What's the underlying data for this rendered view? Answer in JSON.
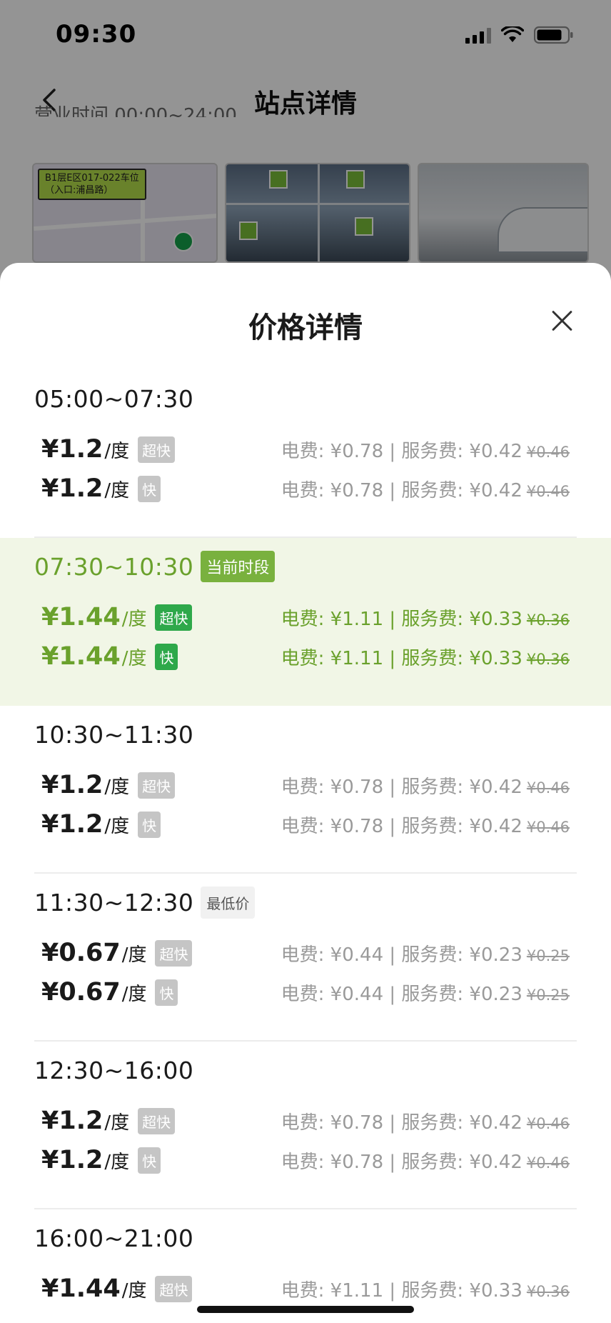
{
  "status_bar": {
    "time": "09:30"
  },
  "header": {
    "title": "站点详情"
  },
  "background": {
    "hours_text": "营业时间 00:00~24:00",
    "map_tag_line1": "B1层E区017-022车位",
    "map_tag_line2": "（入口:浦昌路）"
  },
  "sheet": {
    "title": "价格详情",
    "unit": "/度",
    "periods": [
      {
        "time": "05:00~07:30",
        "rows": [
          {
            "price": "¥1.2",
            "speed": "超快",
            "breakdown": "电费: ¥0.78 | 服务费: ¥0.42",
            "original": "¥0.46"
          },
          {
            "price": "¥1.2",
            "speed": "快",
            "breakdown": "电费: ¥0.78 | 服务费: ¥0.42",
            "original": "¥0.46"
          }
        ]
      },
      {
        "time": "07:30~10:30",
        "badge": "当前时段",
        "rows": [
          {
            "price": "¥1.44",
            "speed": "超快",
            "breakdown": "电费: ¥1.11 | 服务费: ¥0.33",
            "original": "¥0.36"
          },
          {
            "price": "¥1.44",
            "speed": "快",
            "breakdown": "电费: ¥1.11 | 服务费: ¥0.33",
            "original": "¥0.36"
          }
        ]
      },
      {
        "time": "10:30~11:30",
        "rows": [
          {
            "price": "¥1.2",
            "speed": "超快",
            "breakdown": "电费: ¥0.78 | 服务费: ¥0.42",
            "original": "¥0.46"
          },
          {
            "price": "¥1.2",
            "speed": "快",
            "breakdown": "电费: ¥0.78 | 服务费: ¥0.42",
            "original": "¥0.46"
          }
        ]
      },
      {
        "time": "11:30~12:30",
        "badge": "最低价",
        "rows": [
          {
            "price": "¥0.67",
            "speed": "超快",
            "breakdown": "电费: ¥0.44 | 服务费: ¥0.23",
            "original": "¥0.25"
          },
          {
            "price": "¥0.67",
            "speed": "快",
            "breakdown": "电费: ¥0.44 | 服务费: ¥0.23",
            "original": "¥0.25"
          }
        ]
      },
      {
        "time": "12:30~16:00",
        "rows": [
          {
            "price": "¥1.2",
            "speed": "超快",
            "breakdown": "电费: ¥0.78 | 服务费: ¥0.42",
            "original": "¥0.46"
          },
          {
            "price": "¥1.2",
            "speed": "快",
            "breakdown": "电费: ¥0.78 | 服务费: ¥0.42",
            "original": "¥0.46"
          }
        ]
      },
      {
        "time": "16:00~21:00",
        "rows": [
          {
            "price": "¥1.44",
            "speed": "超快",
            "breakdown": "电费: ¥1.11 | 服务费: ¥0.33",
            "original": "¥0.36"
          }
        ]
      }
    ]
  },
  "colors": {
    "accent_green": "#6aa12c",
    "current_bg": "#f1f6e6",
    "speed_green": "#2ea84a"
  }
}
